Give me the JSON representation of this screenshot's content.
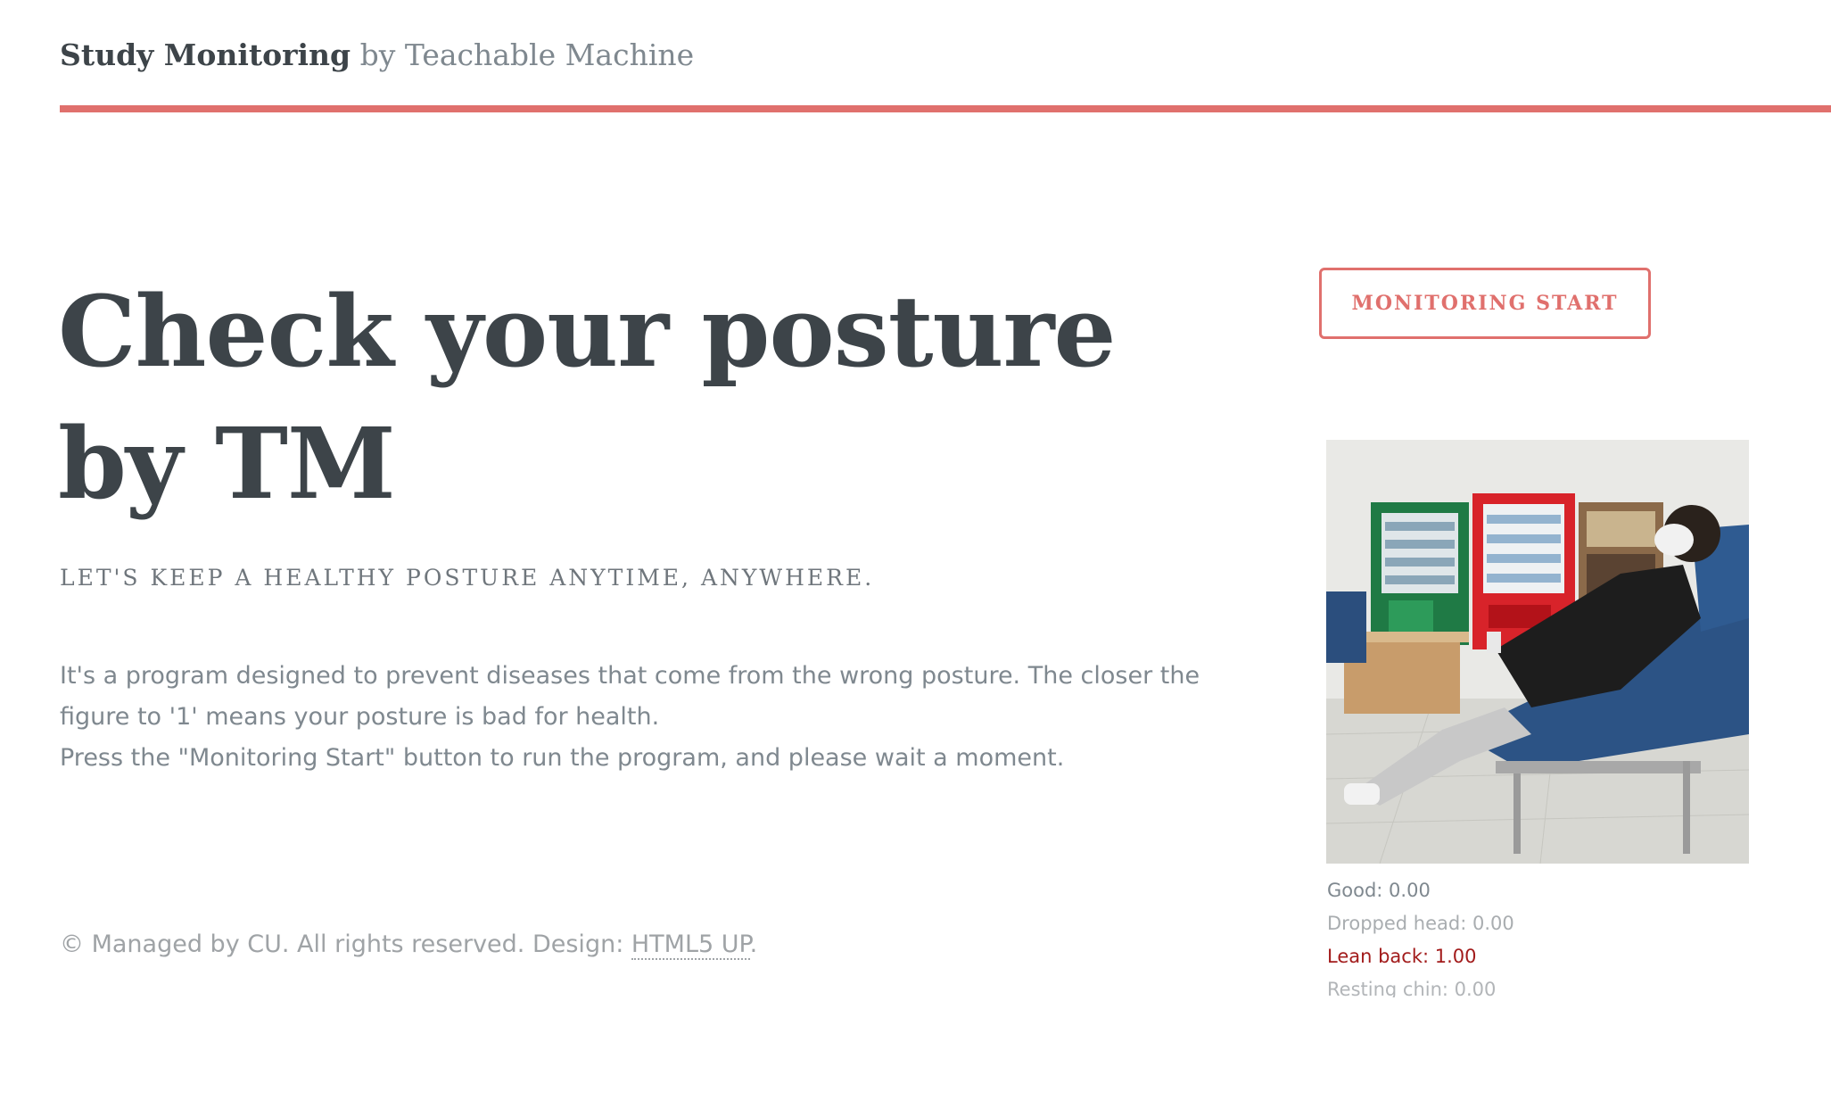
{
  "header": {
    "logo_bold": "Study Monitoring",
    "logo_rest": " by Teachable Machine",
    "accent_color": "#e0706d"
  },
  "hero": {
    "headline_line1": "Check your posture",
    "headline_line2": "by TM",
    "tagline": "LET'S KEEP A HEALTHY POSTURE ANYTIME, ANYWHERE.",
    "description_line1": "It's a program designed to prevent diseases that come from the wrong posture. The closer the figure to '1' means your posture is bad for health.",
    "description_line2": "Press the \"Monitoring Start\" button to run the program, and please wait a moment."
  },
  "controls": {
    "start_button_label": "MONITORING START"
  },
  "webcam": {
    "icon": "webcam-feed-image"
  },
  "predictions": [
    {
      "label": "Good",
      "value": "0.00"
    },
    {
      "label": "Dropped head",
      "value": "0.00"
    },
    {
      "label": "Lean back",
      "value": "1.00"
    },
    {
      "label": "Resting chin",
      "value": "0.00"
    }
  ],
  "prediction_text": {
    "good": "Good: 0.00",
    "dropped": "Dropped head: 0.00",
    "lean": "Lean back: 1.00",
    "resting": "Resting chin: 0.00"
  },
  "footer": {
    "copyright": "© Managed by CU. All rights reserved. Design: ",
    "design_link": "HTML5 UP",
    "end": "."
  }
}
